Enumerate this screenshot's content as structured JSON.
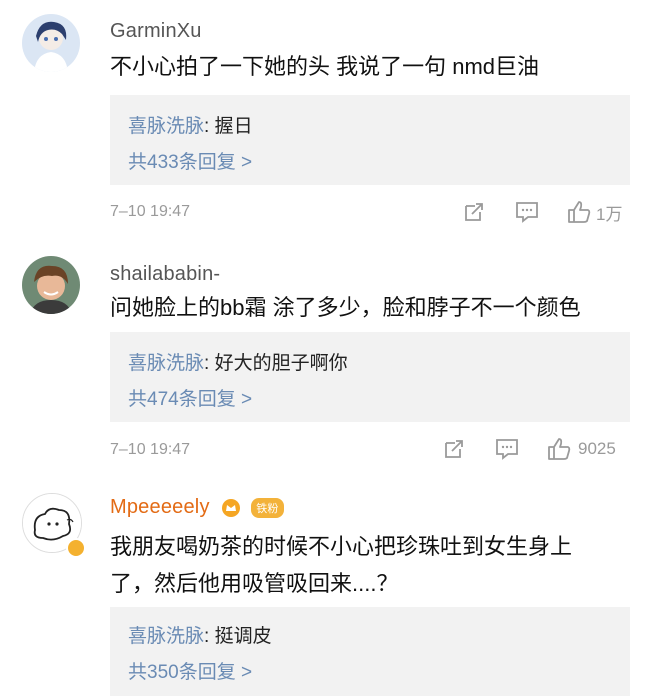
{
  "comments": [
    {
      "username": "GarminXu",
      "text": "不小心拍了一下她的头 我说了一句 nmd巨油",
      "reply": {
        "name": "喜脉洗脉",
        "sep": ": ",
        "text": "握日",
        "count": "共433条回复 >"
      },
      "time": "7–10 19:47",
      "likes": "1万"
    },
    {
      "username": "shailababin-",
      "text": "问她脸上的bb霜 涂了多少，脸和脖子不一个颜色",
      "reply": {
        "name": "喜脉洗脉",
        "sep": ": ",
        "text": "好大的胆子啊你",
        "count": "共474条回复 >"
      },
      "time": "7–10 19:47",
      "likes": "9025"
    },
    {
      "username": "Mpeeeeely",
      "fan_badge": "铁粉",
      "text_line1": "我朋友喝奶茶的时候不小心把珍珠吐到女生身上",
      "text_line2": "了，然后他用吸管吸回来....？",
      "reply": {
        "name": "喜脉洗脉",
        "sep": ": ",
        "text": "挺调皮",
        "count": "共350条回复 >"
      }
    }
  ],
  "colors": {
    "link_blue": "#6a8bb4",
    "vip_orange": "#e36b15",
    "reply_bg": "#f2f2f2",
    "meta_gray": "#9a9a9a"
  },
  "icons": [
    "share-icon",
    "comment-icon",
    "like-icon",
    "crown-icon",
    "verified-badge-icon"
  ]
}
